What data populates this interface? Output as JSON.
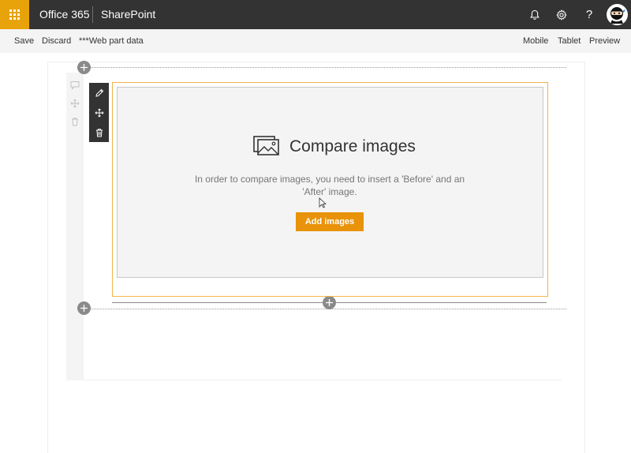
{
  "suite": {
    "brand": "Office 365",
    "app": "SharePoint"
  },
  "commandbar": {
    "save": "Save",
    "discard": "Discard",
    "title": "***Web part data",
    "mobile": "Mobile",
    "tablet": "Tablet",
    "preview": "Preview"
  },
  "webpart": {
    "title": "Compare images",
    "description": "In order to compare images, you need to insert a 'Before' and an 'After' image.",
    "button": "Add images"
  },
  "colors": {
    "suite_bar": "#333333",
    "waffle": "#e8a20a",
    "accent_button": "#e8930a",
    "selection_border": "#f0b54a"
  },
  "icons": [
    "waffle-icon",
    "bell-icon",
    "gear-icon",
    "help-icon",
    "avatar",
    "plus-icon",
    "comment-icon",
    "move-icon",
    "delete-icon",
    "edit-icon",
    "image-icon"
  ]
}
